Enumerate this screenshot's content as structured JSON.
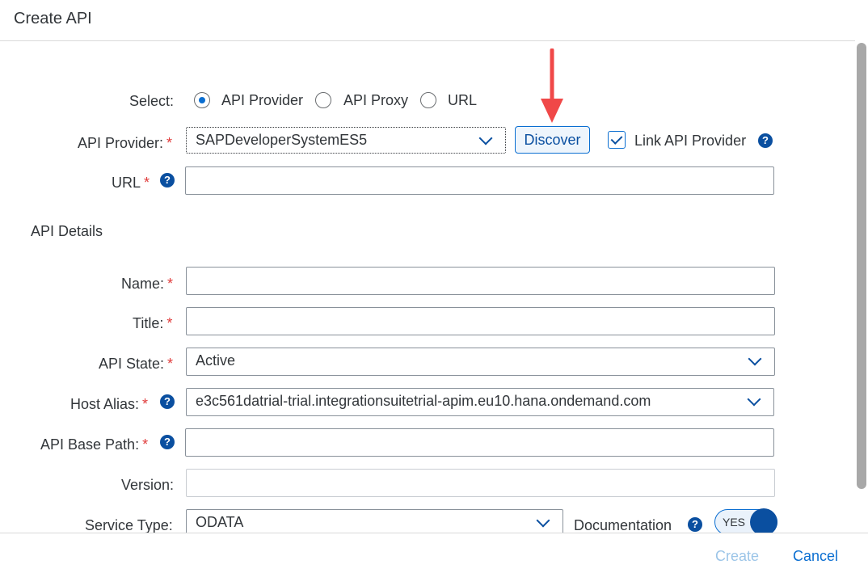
{
  "dialog": {
    "title": "Create API"
  },
  "select": {
    "label": "Select:",
    "options": [
      {
        "label": "API Provider",
        "selected": true
      },
      {
        "label": "API Proxy",
        "selected": false
      },
      {
        "label": "URL",
        "selected": false
      }
    ]
  },
  "api_provider": {
    "label": "API Provider:",
    "value": "SAPDeveloperSystemES5",
    "discover_label": "Discover",
    "link_label": "Link API Provider",
    "link_checked": true
  },
  "url": {
    "label": "URL",
    "value": ""
  },
  "details_heading": "API Details",
  "fields": {
    "name": {
      "label": "Name:",
      "value": ""
    },
    "title": {
      "label": "Title:",
      "value": ""
    },
    "api_state": {
      "label": "API State:",
      "value": "Active"
    },
    "host_alias": {
      "label": "Host Alias:",
      "value": "e3c561datrial-trial.integrationsuitetrial-apim.eu10.hana.ondemand.com"
    },
    "base_path": {
      "label": "API Base Path:",
      "value": ""
    },
    "version": {
      "label": "Version:",
      "value": ""
    },
    "service_type": {
      "label": "Service Type:",
      "value": "ODATA"
    }
  },
  "documentation": {
    "label": "Documentation",
    "toggle_label": "YES"
  },
  "footer": {
    "create_label": "Create",
    "cancel_label": "Cancel"
  },
  "required_mark": "*",
  "help_glyph": "?",
  "colors": {
    "accent": "#0a6ed1",
    "required": "#e03b3b",
    "annotation_arrow": "#f04848"
  }
}
